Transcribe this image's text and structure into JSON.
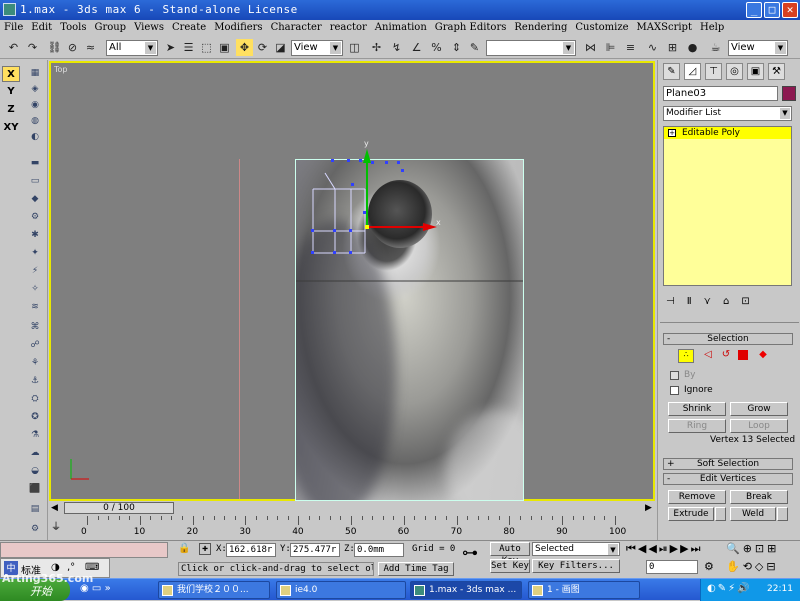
{
  "window": {
    "title": "1.max - 3ds max 6 - Stand-alone License",
    "min": "_",
    "max": "□",
    "close": "✕"
  },
  "menu": [
    "File",
    "Edit",
    "Tools",
    "Group",
    "Views",
    "Create",
    "Modifiers",
    "Character",
    "reactor",
    "Animation",
    "Graph Editors",
    "Rendering",
    "Customize",
    "MAXScript",
    "Help"
  ],
  "toolbar": {
    "selection_filter": "All",
    "ref_coord": "View",
    "named_selection": "",
    "view_dropdown": "View"
  },
  "axis_constraints": [
    "X",
    "Y",
    "Z",
    "XY"
  ],
  "viewport": {
    "label": "Top"
  },
  "time_slider": {
    "label": "0 / 100"
  },
  "ruler_ticks": [
    "0",
    "10",
    "20",
    "30",
    "40",
    "50",
    "60",
    "70",
    "80",
    "90",
    "100"
  ],
  "command_panel": {
    "object_name": "Plane03",
    "object_color": "#8c1850",
    "modifier_list": "Modifier List",
    "stack_item": "Editable Poly",
    "selection_rollout": "Selection",
    "by_label": "By",
    "ignore_label": "Ignore",
    "shrink": "Shrink",
    "grow": "Grow",
    "ring": "Ring",
    "loop": "Loop",
    "vertex_status": "Vertex 13 Selected",
    "soft_selection": "Soft Selection",
    "edit_vertices": "Edit Vertices",
    "remove": "Remove",
    "break": "Break",
    "extrude": "Extrude",
    "weld": "Weld"
  },
  "status": {
    "x_label": "X:",
    "x_value": "162.618r",
    "y_label": "Y:",
    "y_value": "275.477r",
    "z_label": "Z:",
    "z_value": "0.0mm",
    "grid": "Grid = 0",
    "auto_key": "Auto Key",
    "set_key": "Set Key",
    "key_mode": "Selected",
    "key_filters": "Key Filters...",
    "prompt": "Click or click-and-drag to select ol",
    "add_time_tag": "Add Time Tag",
    "frame": "0"
  },
  "ime": {
    "label": "标准"
  },
  "watermark": "Arting365.com",
  "taskbar": {
    "start": "开始",
    "tasks": [
      "我们学校２００...",
      "ie4.0",
      "1.max - 3ds max ...",
      "1 - 画图"
    ],
    "clock": "22:11"
  }
}
